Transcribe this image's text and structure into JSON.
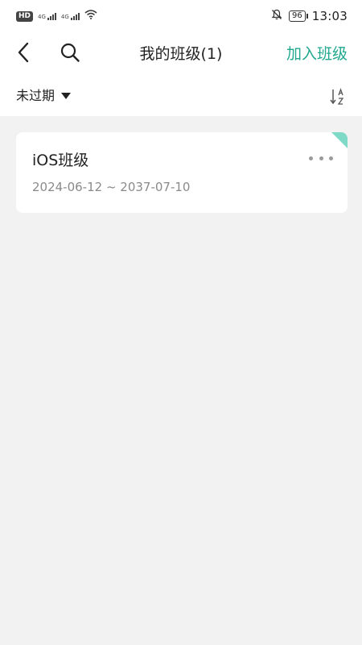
{
  "status_bar": {
    "hd_label": "HD",
    "network1": "4G",
    "network2": "4G",
    "battery": "96",
    "time": "13:03"
  },
  "header": {
    "title": "我的班级(1)",
    "join_label": "加入班级"
  },
  "filter": {
    "selected": "未过期"
  },
  "classes": [
    {
      "name": "iOS班级",
      "dates": "2024-06-12 ~ 2037-07-10"
    }
  ],
  "colors": {
    "accent": "#21a88f",
    "corner_marker": "#7fd9c7",
    "background": "#f2f2f2"
  },
  "icons": {
    "back": "chevron-left-icon",
    "search": "search-icon",
    "sort": "sort-az-icon",
    "more": "more-horizontal-icon",
    "mute": "bell-off-icon",
    "wifi": "wifi-icon"
  }
}
